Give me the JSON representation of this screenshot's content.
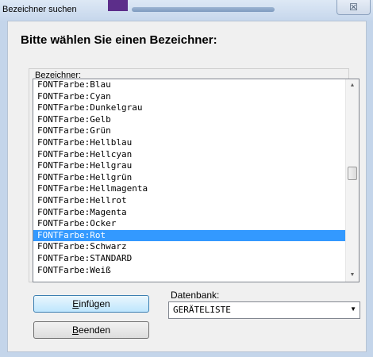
{
  "window": {
    "title": "Bezeichner suchen",
    "close_glyph": "☒",
    "heading": "Bitte wählen Sie einen Bezeichner:"
  },
  "list": {
    "label": "Bezeichner:",
    "items": [
      "FONTFarbe:Blau",
      "FONTFarbe:Cyan",
      "FONTFarbe:Dunkelgrau",
      "FONTFarbe:Gelb",
      "FONTFarbe:Grün",
      "FONTFarbe:Hellblau",
      "FONTFarbe:Hellcyan",
      "FONTFarbe:Hellgrau",
      "FONTFarbe:Hellgrün",
      "FONTFarbe:Hellmagenta",
      "FONTFarbe:Hellrot",
      "FONTFarbe:Magenta",
      "FONTFarbe:Ocker",
      "FONTFarbe:Rot",
      "FONTFarbe:Schwarz",
      "FONTFarbe:STANDARD",
      "FONTFarbe:Weiß"
    ],
    "selected_index": 13
  },
  "buttons": {
    "insert_mnemonic": "E",
    "insert_rest": "infügen",
    "exit_mnemonic": "B",
    "exit_rest": "eenden"
  },
  "database": {
    "label": "Datenbank:",
    "value": "GERÄTELISTE"
  },
  "colors": {
    "selection": "#3399ff",
    "window_frame": "#c4d5ea",
    "title_accent": "#5c2e8a"
  }
}
